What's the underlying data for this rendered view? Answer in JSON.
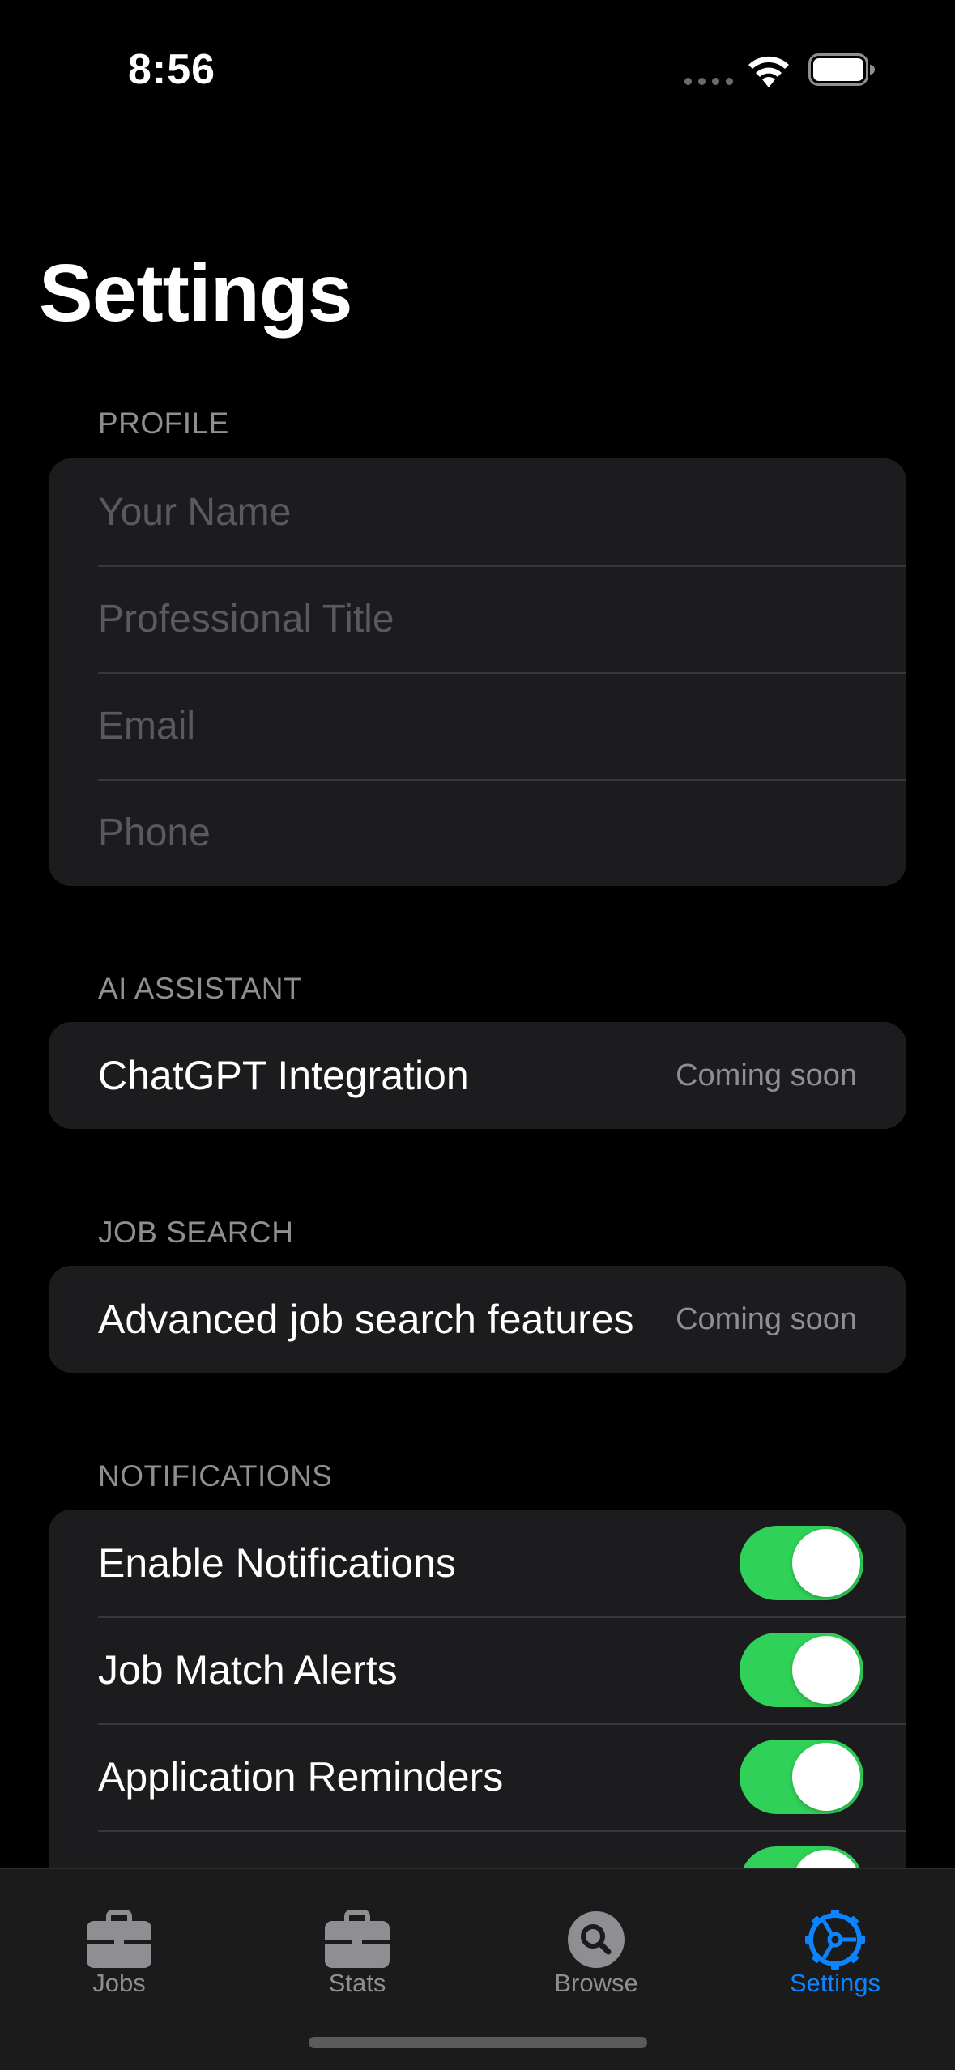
{
  "status_bar": {
    "time": "8:56"
  },
  "page": {
    "title": "Settings"
  },
  "sections": {
    "profile": {
      "header": "PROFILE",
      "fields": [
        {
          "placeholder": "Your Name",
          "value": ""
        },
        {
          "placeholder": "Professional Title",
          "value": ""
        },
        {
          "placeholder": "Email",
          "value": ""
        },
        {
          "placeholder": "Phone",
          "value": ""
        }
      ]
    },
    "ai_assistant": {
      "header": "AI ASSISTANT",
      "label": "ChatGPT Integration",
      "value": "Coming soon"
    },
    "job_search": {
      "header": "JOB SEARCH",
      "label": "Advanced job search features",
      "value": "Coming soon"
    },
    "notifications": {
      "header": "NOTIFICATIONS",
      "items": [
        {
          "label": "Enable Notifications",
          "on": true
        },
        {
          "label": "Job Match Alerts",
          "on": true
        },
        {
          "label": "Application Reminders",
          "on": true
        },
        {
          "label": "",
          "on": true
        }
      ]
    }
  },
  "tab_bar": {
    "tabs": [
      {
        "label": "Jobs",
        "icon": "briefcase-icon",
        "active": false
      },
      {
        "label": "Stats",
        "icon": "briefcase-icon",
        "active": false
      },
      {
        "label": "Browse",
        "icon": "search-icon",
        "active": false
      },
      {
        "label": "Settings",
        "icon": "gear-icon",
        "active": true
      }
    ]
  },
  "colors": {
    "background": "#000000",
    "card": "#1c1c1e",
    "toggle_on": "#30d158",
    "accent": "#0a84ff",
    "secondary_text": "#8e8e93"
  }
}
